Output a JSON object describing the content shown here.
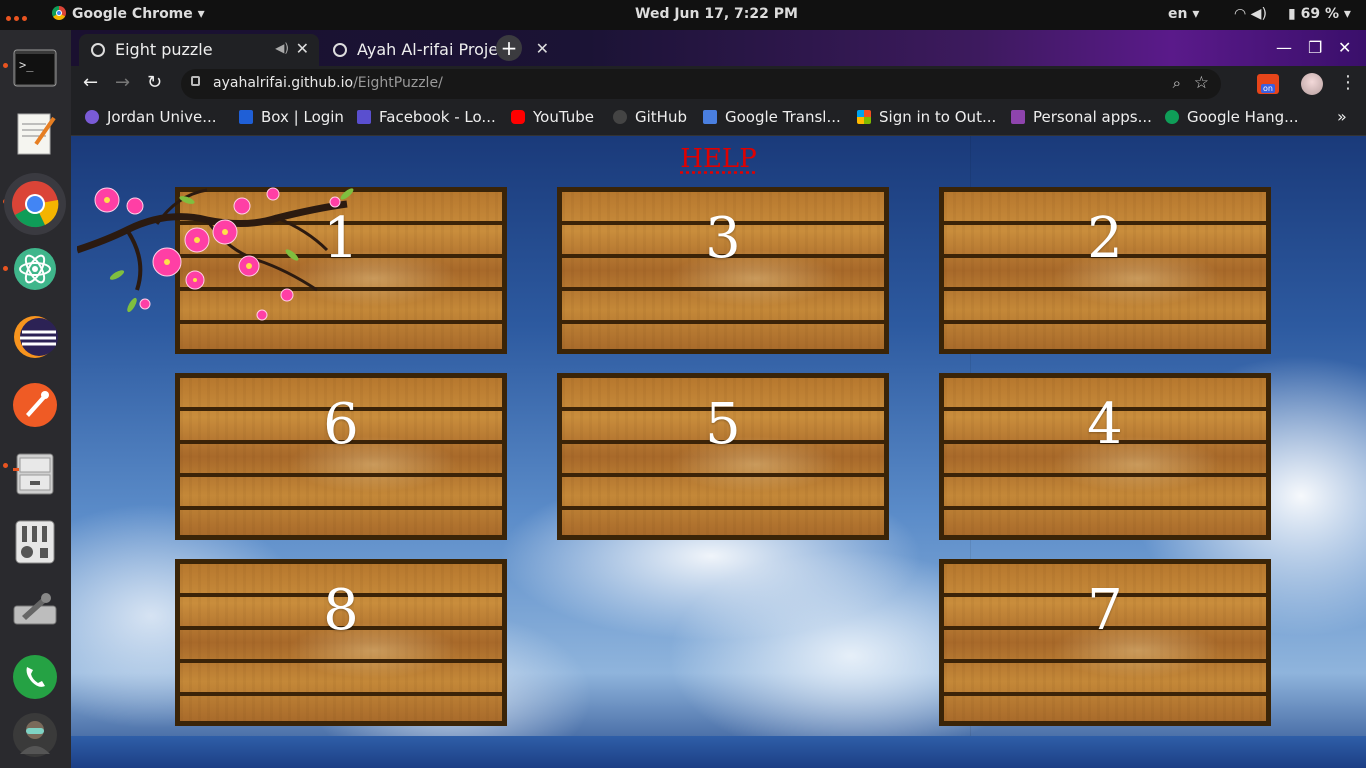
{
  "system": {
    "app_name": "Google Chrome",
    "clock": "Wed Jun 17,  7:22 PM",
    "language": "en",
    "battery": "69 %"
  },
  "browser": {
    "tabs": [
      {
        "title": "Eight puzzle",
        "active": true
      },
      {
        "title": "Ayah Al-rifai Projects",
        "active": false
      }
    ],
    "url_host": "ayahalrifai.github.io",
    "url_path": "/EightPuzzle/",
    "bookmarks": [
      {
        "label": "Jordan Unive...",
        "icon": "jordan-university-icon",
        "color": "#7a5bd6"
      },
      {
        "label": "Box | Login",
        "icon": "box-icon",
        "color": "#1f5fd6"
      },
      {
        "label": "Facebook - Lo...",
        "icon": "facebook-icon",
        "color": "#5a4fcf"
      },
      {
        "label": "YouTube",
        "icon": "youtube-icon",
        "color": "#ff0000"
      },
      {
        "label": "GitHub",
        "icon": "github-icon",
        "color": "#444444"
      },
      {
        "label": "Google Transl...",
        "icon": "google-translate-icon",
        "color": "#4a7fe0"
      },
      {
        "label": "Sign in to Out...",
        "icon": "microsoft-icon",
        "color": "#f25022"
      },
      {
        "label": "Personal apps...",
        "icon": "personal-apps-icon",
        "color": "#8e44ad"
      },
      {
        "label": "Google Hang...",
        "icon": "hangouts-icon",
        "color": "#0f9d58"
      }
    ]
  },
  "page": {
    "help_link": "HELP",
    "tiles": [
      "1",
      "3",
      "2",
      "6",
      "5",
      "4",
      "8",
      "",
      "7"
    ]
  },
  "dock_icons": [
    "terminal-icon",
    "text-editor-icon",
    "chrome-icon",
    "atom-icon",
    "eclipse-icon",
    "postman-icon",
    "file-cabinet-icon",
    "mixer-icon",
    "settings-tools-icon",
    "whatsapp-icon",
    "user-avatar-icon"
  ]
}
